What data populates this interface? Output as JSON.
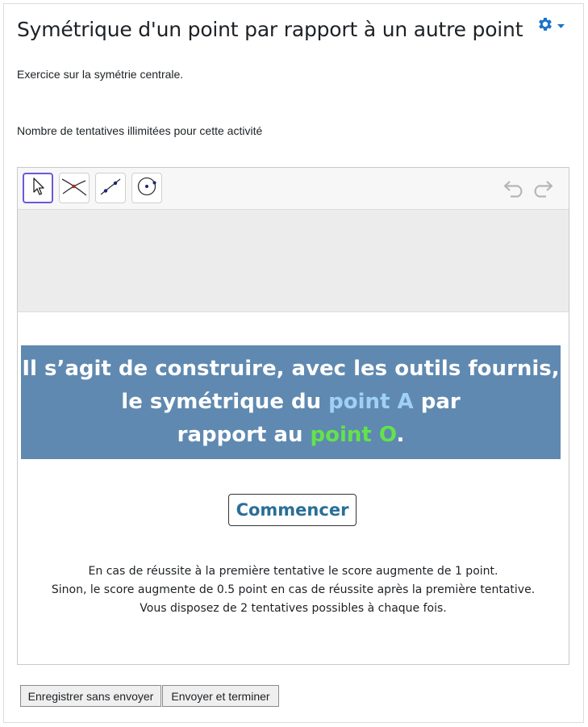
{
  "page": {
    "title": "Symétrique d'un point par rapport à un autre point",
    "description": "Exercice sur la symétrie centrale.",
    "attempts_info": "Nombre de tentatives illimitées pour cette activité",
    "settings_icon": "gear-icon"
  },
  "applet": {
    "toolbar": {
      "tools": [
        {
          "name": "move-tool",
          "icon": "cursor-arrow-icon",
          "active": true
        },
        {
          "name": "intersect-tool",
          "icon": "intersection-icon",
          "active": false
        },
        {
          "name": "segment-tool",
          "icon": "segment-icon",
          "active": false
        },
        {
          "name": "circle-tool",
          "icon": "circle-center-point-icon",
          "active": false
        }
      ],
      "undo_icon": "undo-icon",
      "redo_icon": "redo-icon"
    },
    "banner": {
      "line1": "Il s’agit de construire, avec les outils fournis,",
      "line2_pre": "le symétrique du ",
      "line2_highlight": "point A",
      "line2_post": " par",
      "line3_pre": "rapport au ",
      "line3_highlight": "point O",
      "line3_post": ".",
      "highlight_colors": {
        "point_A": "#9fd1f5",
        "point_O": "#63e34b"
      },
      "background": "#5f89b0"
    },
    "start_button": "Commencer",
    "rules": [
      "En cas de réussite à la première tentative le score augmente de 1 point.",
      "Sinon, le score augmente de 0.5 point en cas de réussite après la première tentative.",
      "Vous disposez de 2 tentatives possibles à chaque fois."
    ]
  },
  "actions": {
    "save_label": "Enregistrer sans envoyer",
    "submit_label": "Envoyer et terminer"
  }
}
